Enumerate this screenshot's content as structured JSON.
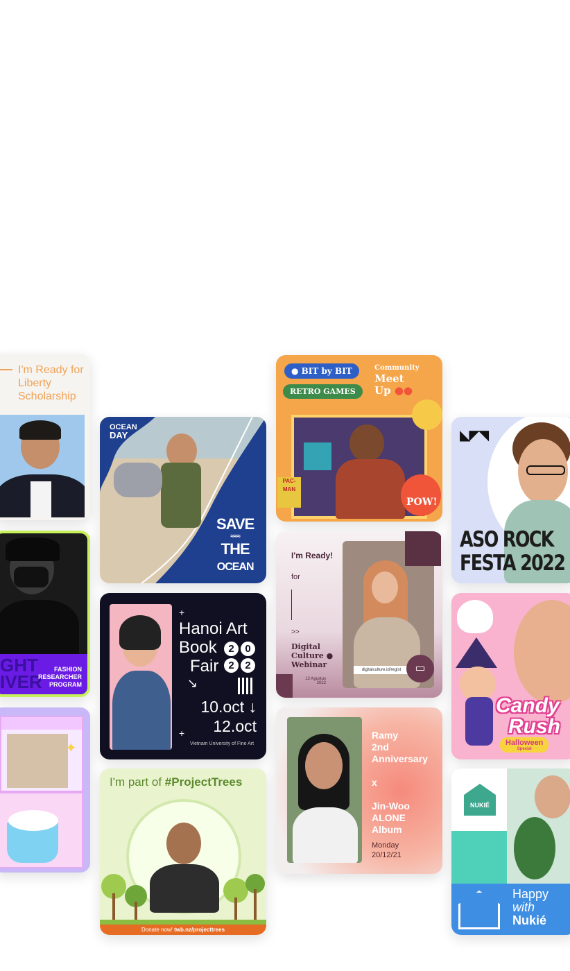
{
  "cards": {
    "liberty": {
      "title": "I'm Ready for Liberty Scholarship"
    },
    "fashion": {
      "line1": "FASHION",
      "line2": "RESEARCHER",
      "line3": "PROGRAM",
      "big1": "GHT",
      "big2": "IVER"
    },
    "ocean": {
      "badge1": "OCEAN",
      "badge2": "DAY",
      "title1": "SAVE",
      "title2": "THE",
      "title3": "OCEAN"
    },
    "hanoi": {
      "title1": "Hanoi Art",
      "title2": "Book",
      "title3": "Fair",
      "year": [
        "2",
        "0",
        "2",
        "2"
      ],
      "date1": "10.oct",
      "date2": "12.oct",
      "footer": "Vietnam University of Fine Art"
    },
    "trees": {
      "prefix": "I'm part of ",
      "hashtag": "#ProjectTrees",
      "footer_prefix": "Donate now! ",
      "footer_link": "twb.nz/projecttrees"
    },
    "retro": {
      "tag1": "BIT by BIT",
      "tag2": "RETRO GAMES",
      "side1": "Community",
      "side2": "Meet",
      "side3": "Up",
      "pow": "POW!",
      "pacman": "PAC-MAN"
    },
    "digital": {
      "ready": "I'm Ready!",
      "for": "for",
      "arrows": ">>",
      "line1": "Digital",
      "line2": "Culture",
      "line3": "Webinar",
      "date1": "12 Agustus",
      "date2": "2022",
      "link": "digitalculture.id/regist"
    },
    "ramy": {
      "l1": "Ramy",
      "l2": "2nd",
      "l3": "Anniversary",
      "x": "x",
      "l4": "Jin-Woo",
      "l5": "ALONE",
      "l6": "Album",
      "d1": "Monday",
      "d2": "20/12/21"
    },
    "aso": {
      "line1": "ASO ROCK",
      "line2": "FESTA 2022"
    },
    "candy": {
      "line1": "Candy",
      "line2": "Rush",
      "line3": "Halloween",
      "line4": "Special"
    },
    "nukie": {
      "logo": "NUKIÉ",
      "line1": "Happy",
      "line2": "with",
      "line3": "Nukié"
    }
  },
  "colors": {
    "accent_orange": "#f0a257",
    "neon_green": "#c6f15a",
    "ocean_blue": "#1f3f8f",
    "trees_green": "#5d8a2c",
    "nukie_blue": "#3e8ee4"
  }
}
